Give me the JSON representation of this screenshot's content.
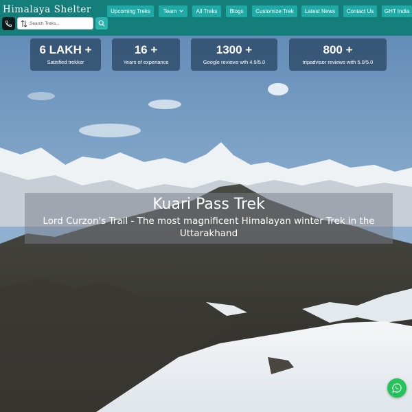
{
  "header": {
    "logo": "Himalaya Shelter",
    "nav": [
      {
        "label": "Upcoming Treks"
      },
      {
        "label": "Team"
      },
      {
        "label": "All Treks"
      },
      {
        "label": "Blogs"
      },
      {
        "label": "Customize Trek"
      },
      {
        "label": "Latest News"
      },
      {
        "label": "Contact Us"
      },
      {
        "label": "GHT India"
      }
    ],
    "search": {
      "placeholder": "Search Treks...",
      "value": ""
    }
  },
  "stats": [
    {
      "value": "6 LAKH +",
      "label": "Satisfied trekker"
    },
    {
      "value": "16 +",
      "label": "Years of experiance"
    },
    {
      "value": "1300 +",
      "label": "Google reviews wth 4.9/5.0"
    },
    {
      "value": "800 +",
      "label": "tripadvisor reviews with 5.0/5.0"
    }
  ],
  "hero": {
    "title": "Kuari Pass Trek",
    "subtitle": "Lord Curzon's Trail - The most magnificent Himalayan winter Trek in the Uttarakhand"
  },
  "colors": {
    "header_bg": "#137e7a",
    "nav_bg": "#1faaa5",
    "whatsapp": "#25c45a"
  },
  "icons": {
    "phone": "phone-icon",
    "sort": "sort-icon",
    "search": "search-icon",
    "whatsapp": "whatsapp-icon"
  }
}
